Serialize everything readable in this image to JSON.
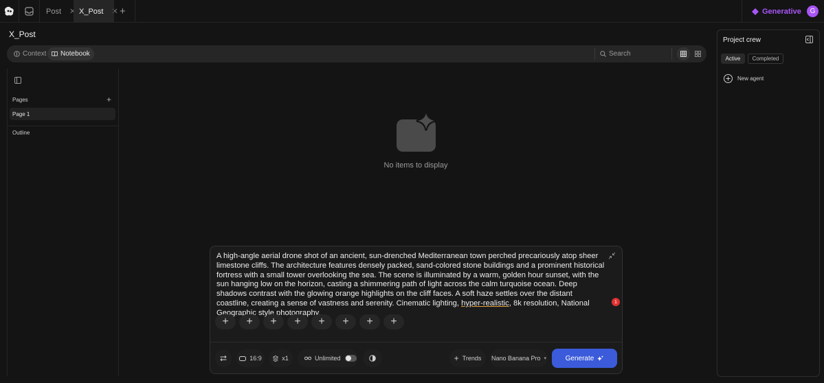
{
  "topbar": {
    "tabs": [
      {
        "label": "Post"
      },
      {
        "label": "X_Post"
      }
    ],
    "generative_label": "Generative",
    "avatar_letter": "G"
  },
  "page": {
    "title": "X_Post"
  },
  "toolbar": {
    "context_label": "Context",
    "notebook_label": "Notebook",
    "search_placeholder": "Search"
  },
  "sidebar": {
    "pages_label": "Pages",
    "pages": [
      {
        "label": "Page 1"
      }
    ],
    "outline_label": "Outline"
  },
  "main": {
    "empty_text": "No items to display"
  },
  "crew": {
    "title": "Project crew",
    "tabs": [
      {
        "label": "Active"
      },
      {
        "label": "Completed"
      }
    ],
    "new_agent_label": "New agent"
  },
  "prompt": {
    "text_before": "A high-angle aerial drone shot of an ancient, sun-drenched Mediterranean town perched precariously atop sheer limestone cliffs. The architecture features densely packed, sand-colored stone buildings and a prominent historical fortress with a small tower overlooking the sea. The scene is illuminated by a warm, golden hour sunset, with the sun hanging low on the horizon, casting a shimmering path of light across the calm turquoise ocean. Deep shadows contrast with the glowing orange highlights on the cliff faces. A soft haze settles over the distant coastline, creating a sense of vastness and serenity. Cinematic lighting, ",
    "text_flagged": "hyper-realistic",
    "text_after": ", 8k resolution, National Geographic style photography.",
    "badge_count": "1",
    "aspect_label": "16:9",
    "count_label": "x1",
    "unlimited_label": "Unlimited",
    "unlimited_on": false,
    "trends_label": "Trends",
    "model_label": "Nano Banana Pro",
    "generate_label": "Generate"
  },
  "colors": {
    "accent_purple": "#a855f7",
    "generate_blue": "#3b5bdb",
    "badge_red": "#e03131"
  }
}
